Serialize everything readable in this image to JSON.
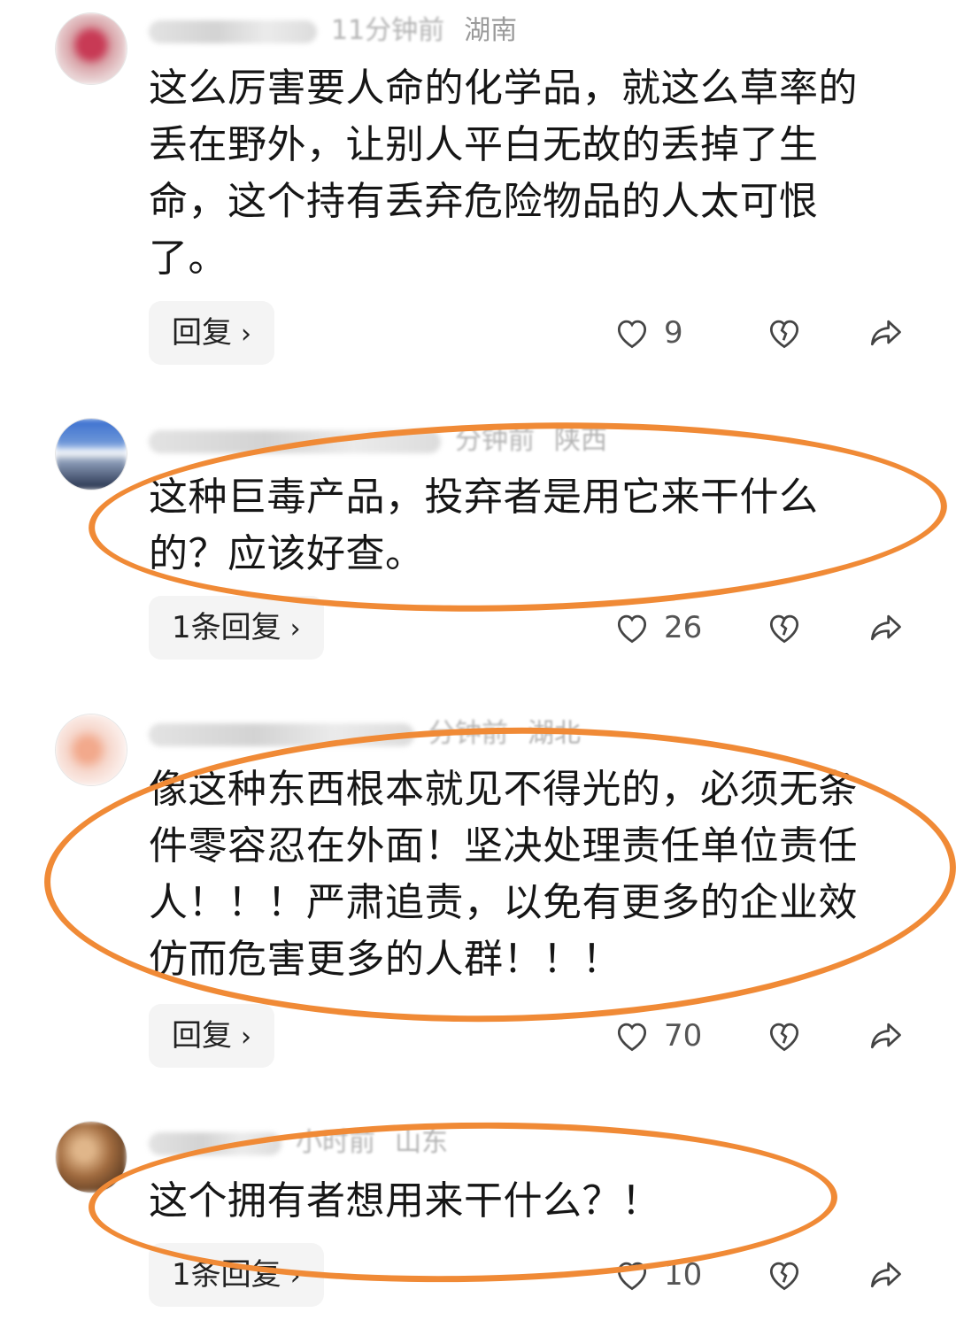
{
  "comments": [
    {
      "region": "湖南",
      "text": "这么厉害要人命的化学品，就这么草率的丢在野外，让别人平白无故的丢掉了生命，这个持有丢弃危险物品的人太可恨了。",
      "reply_label": "回复",
      "likes": "9",
      "avatar_color": "#c8707a"
    },
    {
      "region": "陕西",
      "text": "这种巨毒产品，投弃者是用它来干什么的？应该好查。",
      "reply_label": "1条回复",
      "likes": "26",
      "avatar_color": "#5a7fb8"
    },
    {
      "region": "湖北",
      "text": "像这种东西根本就见不得光的，必须无条件零容忍在外面！坚决处理责任单位责任人！！！严肃追责，以免有更多的企业效仿而危害更多的人群！！！",
      "reply_label": "回复",
      "likes": "70",
      "avatar_color": "#e8b8b0"
    },
    {
      "region": "山东",
      "text": "这个拥有者想用来干什么？！",
      "reply_label": "1条回复",
      "likes": "10",
      "avatar_color": "#9a6a45"
    }
  ],
  "icons": {
    "like": "heart-outline-icon",
    "dislike": "broken-heart-icon",
    "share": "share-arrow-icon",
    "chevron": "chevron-right-icon"
  },
  "colors": {
    "highlight_ellipse": "#f08a36",
    "reply_button_bg": "#f4f4f4"
  }
}
